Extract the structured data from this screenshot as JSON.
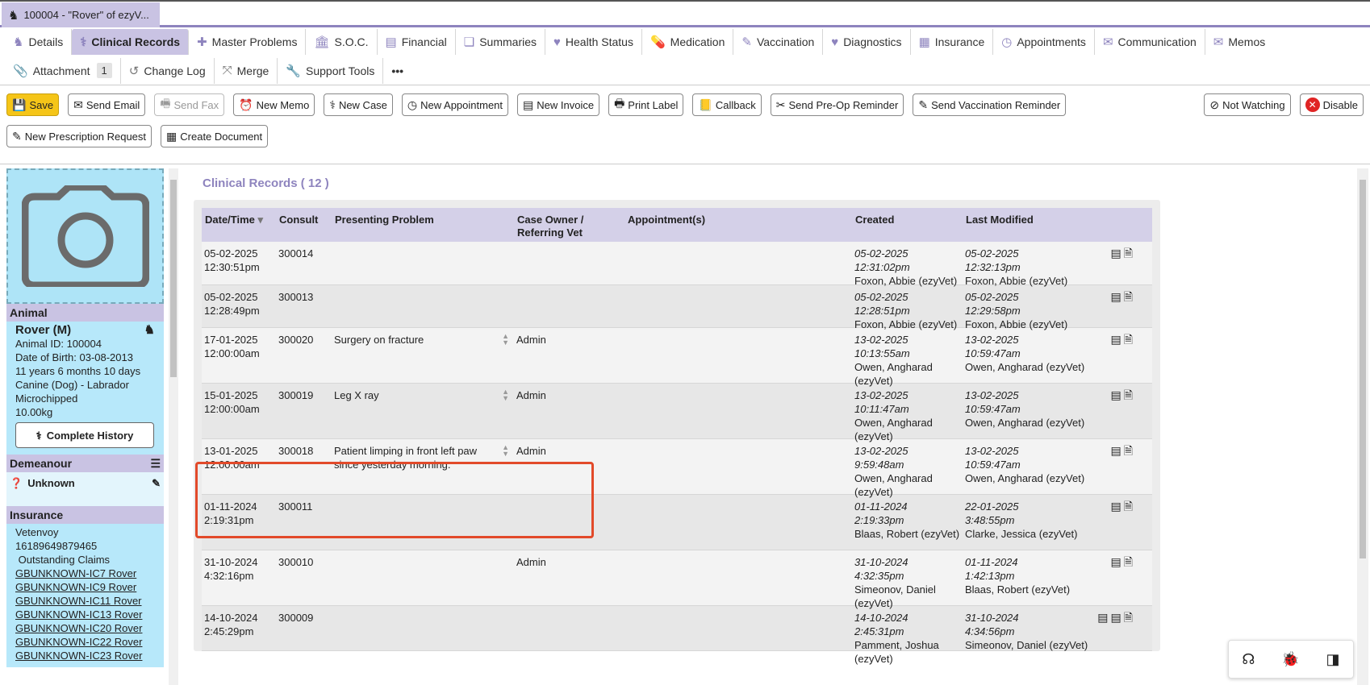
{
  "window": {
    "title": "100004 - \"Rover\" of ezyV..."
  },
  "tabs": [
    {
      "label": "Details",
      "icon": "dog-icon",
      "glyph": "♞"
    },
    {
      "label": "Clinical Records",
      "icon": "stethoscope-icon",
      "glyph": "⚕",
      "active": true
    },
    {
      "label": "Master Problems",
      "icon": "plus-square-icon",
      "glyph": "✚"
    },
    {
      "label": "S.O.C.",
      "icon": "building-icon",
      "glyph": "🏛"
    },
    {
      "label": "Financial",
      "icon": "ledger-icon",
      "glyph": "▤"
    },
    {
      "label": "Summaries",
      "icon": "summaries-icon",
      "glyph": "❏"
    },
    {
      "label": "Health Status",
      "icon": "heart-icon",
      "glyph": "♥"
    },
    {
      "label": "Medication",
      "icon": "pill-icon",
      "glyph": "💊"
    },
    {
      "label": "Vaccination",
      "icon": "syringe-icon",
      "glyph": "✎"
    },
    {
      "label": "Diagnostics",
      "icon": "heart-search-icon",
      "glyph": "♥"
    },
    {
      "label": "Insurance",
      "icon": "insurance-icon",
      "glyph": "▦"
    },
    {
      "label": "Appointments",
      "icon": "clock-icon",
      "glyph": "◷"
    },
    {
      "label": "Communication",
      "icon": "envelope-icon",
      "glyph": "✉"
    },
    {
      "label": "Memos",
      "icon": "memo-envelope-icon",
      "glyph": "✉"
    }
  ],
  "tabs2": [
    {
      "label": "Attachment",
      "icon": "paperclip-icon",
      "glyph": "📎",
      "badge": "1"
    },
    {
      "label": "Change Log",
      "icon": "history-icon",
      "glyph": "↺"
    },
    {
      "label": "Merge",
      "icon": "merge-icon",
      "glyph": "⤧"
    },
    {
      "label": "Support Tools",
      "icon": "wrench-icon",
      "glyph": "🔧"
    },
    {
      "label": "•••",
      "icon": "more-icon",
      "glyph": ""
    }
  ],
  "toolbar": {
    "save": "Save",
    "send_email": "Send Email",
    "send_fax": "Send Fax",
    "new_memo": "New Memo",
    "new_case": "New Case",
    "new_appointment": "New Appointment",
    "new_invoice": "New Invoice",
    "print_label": "Print Label",
    "callback": "Callback",
    "send_preop": "Send Pre-Op Reminder",
    "send_vacc": "Send Vaccination Reminder",
    "not_watching": "Not Watching",
    "disable": "Disable",
    "new_prescription": "New Prescription Request",
    "create_document": "Create Document"
  },
  "sidebar": {
    "animal_header": "Animal",
    "animal_name": "Rover (M)",
    "animal_id": "Animal ID: 100004",
    "dob": "Date of Birth: 03-08-2013",
    "age": "11 years 6 months 10 days",
    "breed": "Canine (Dog) - Labrador",
    "microchip": "Microchipped",
    "weight": "10.00kg",
    "history_button": "Complete History",
    "demeanour_header": "Demeanour",
    "demeanour_value": "Unknown",
    "insurance_header": "Insurance",
    "insurer": "Vetenvoy",
    "policy": "16189649879465",
    "outstanding": " Outstanding Claims",
    "claims": [
      "GBUNKNOWN-IC7 Rover",
      "GBUNKNOWN-IC9 Rover",
      "GBUNKNOWN-IC11 Rover",
      "GBUNKNOWN-IC13 Rover",
      "GBUNKNOWN-IC20 Rover",
      "GBUNKNOWN-IC22 Rover",
      "GBUNKNOWN-IC23 Rover"
    ]
  },
  "records": {
    "title": "Clinical Records ( 12 )",
    "columns": [
      "Date/Time",
      "Consult",
      "Presenting Problem",
      "Case Owner / Referring Vet",
      "Appointment(s)",
      "Created",
      "Last Modified",
      ""
    ],
    "rows": [
      {
        "date": "05-02-2025",
        "time": "12:30:51pm",
        "consult": "300014",
        "problem": "",
        "owner": "",
        "created_date": "05-02-2025",
        "created_time": "12:31:02pm",
        "created_by": "Foxon, Abbie (ezyVet)",
        "mod_date": "05-02-2025",
        "mod_time": "12:32:13pm",
        "mod_by": "Foxon, Abbie (ezyVet)"
      },
      {
        "date": "05-02-2025",
        "time": "12:28:49pm",
        "consult": "300013",
        "problem": "",
        "owner": "",
        "created_date": "05-02-2025",
        "created_time": "12:28:51pm",
        "created_by": "Foxon, Abbie (ezyVet)",
        "mod_date": "05-02-2025",
        "mod_time": "12:29:58pm",
        "mod_by": "Foxon, Abbie (ezyVet)"
      },
      {
        "date": "17-01-2025",
        "time": "12:00:00am",
        "consult": "300020",
        "problem": "Surgery on fracture",
        "owner": "Admin",
        "created_date": "13-02-2025",
        "created_time": "10:13:55am",
        "created_by": "Owen, Angharad (ezyVet)",
        "mod_date": "13-02-2025",
        "mod_time": "10:59:47am",
        "mod_by": "Owen, Angharad (ezyVet)"
      },
      {
        "date": "15-01-2025",
        "time": "12:00:00am",
        "consult": "300019",
        "problem": "Leg X ray",
        "owner": "Admin",
        "created_date": "13-02-2025",
        "created_time": "10:11:47am",
        "created_by": "Owen, Angharad (ezyVet)",
        "mod_date": "13-02-2025",
        "mod_time": "10:59:47am",
        "mod_by": "Owen, Angharad (ezyVet)"
      },
      {
        "date": "13-01-2025",
        "time": "12:00:00am",
        "consult": "300018",
        "problem": "Patient limping in front left paw since yesterday morning.",
        "owner": "Admin",
        "created_date": "13-02-2025",
        "created_time": "9:59:48am",
        "created_by": "Owen, Angharad (ezyVet)",
        "mod_date": "13-02-2025",
        "mod_time": "10:59:47am",
        "mod_by": "Owen, Angharad (ezyVet)"
      },
      {
        "date": "01-11-2024",
        "time": "2:19:31pm",
        "consult": "300011",
        "problem": "",
        "owner": "",
        "created_date": "01-11-2024",
        "created_time": "2:19:33pm",
        "created_by": "Blaas, Robert (ezyVet)",
        "mod_date": "22-01-2025",
        "mod_time": "3:48:55pm",
        "mod_by": "Clarke, Jessica (ezyVet)"
      },
      {
        "date": "31-10-2024",
        "time": "4:32:16pm",
        "consult": "300010",
        "problem": "",
        "owner": "Admin",
        "created_date": "31-10-2024",
        "created_time": "4:32:35pm",
        "created_by": "Simeonov, Daniel (ezyVet)",
        "mod_date": "01-11-2024",
        "mod_time": "1:42:13pm",
        "mod_by": "Blaas, Robert (ezyVet)"
      },
      {
        "date": "14-10-2024",
        "time": "2:45:29pm",
        "consult": "300009",
        "problem": "",
        "owner": "",
        "created_date": "14-10-2024",
        "created_time": "2:45:31pm",
        "created_by": "Pamment, Joshua (ezyVet)",
        "mod_date": "31-10-2024",
        "mod_time": "4:34:56pm",
        "mod_by": "Simeonov, Daniel (ezyVet)"
      }
    ]
  }
}
